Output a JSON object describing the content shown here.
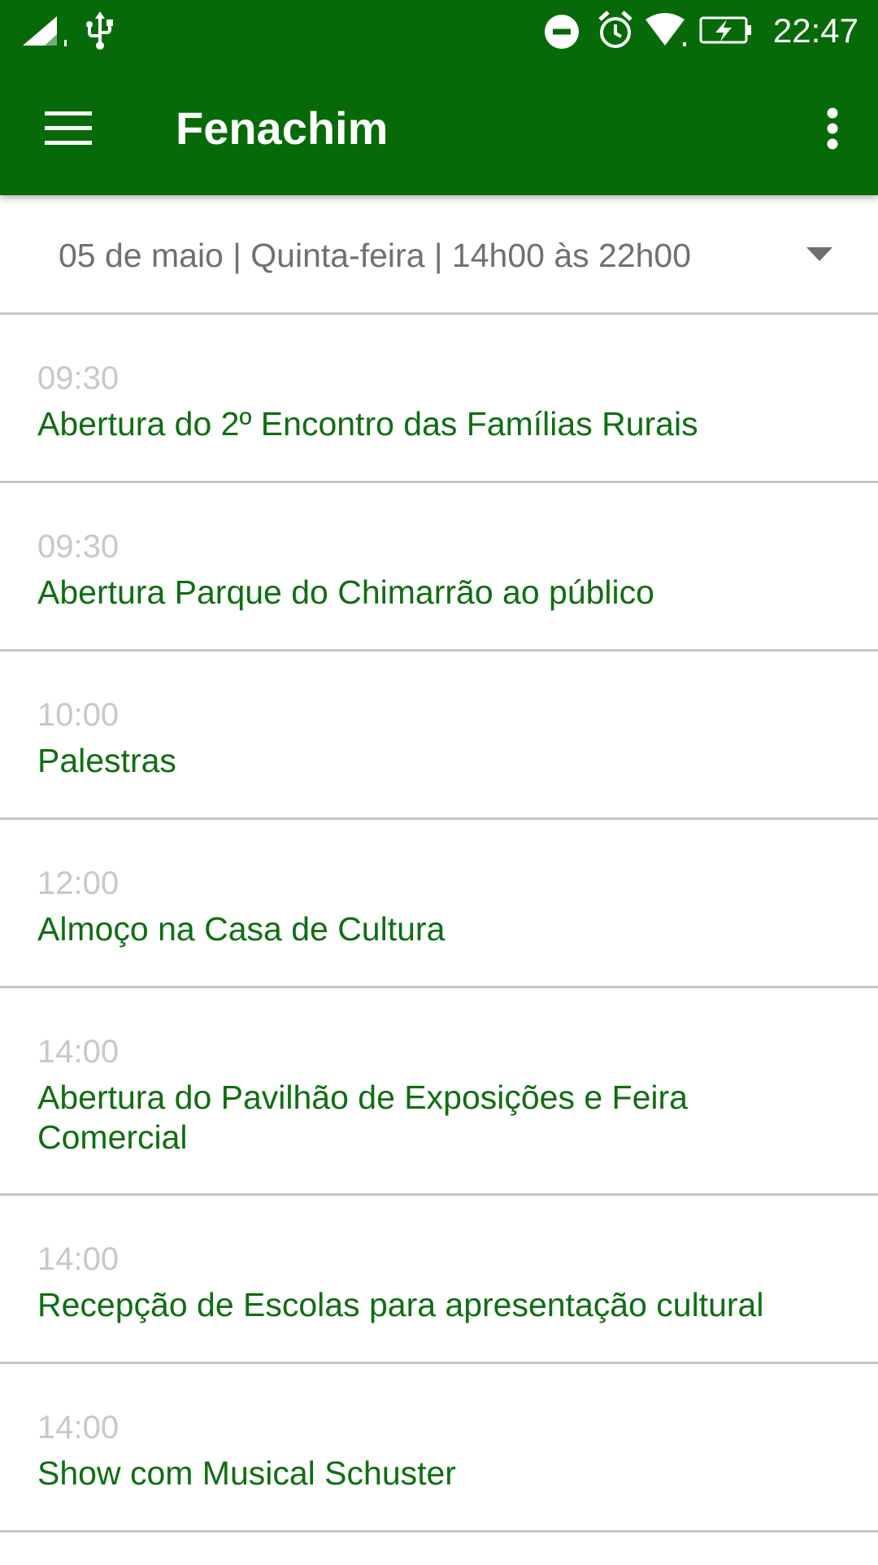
{
  "status_bar": {
    "time": "22:47",
    "icons": [
      "signal-icon",
      "usb-icon",
      "do-not-disturb-icon",
      "alarm-icon",
      "wifi-icon",
      "battery-charging-icon"
    ],
    "color": "#076a09"
  },
  "app_bar": {
    "title": "Fenachim",
    "menu_icon": "hamburger-menu-icon",
    "overflow_icon": "more-vert-icon",
    "color": "#076a09"
  },
  "date_selector": {
    "selected": "05 de maio | Quinta-feira | 14h00 às 22h00",
    "icon": "arrow-drop-down-icon"
  },
  "events": [
    {
      "time": "09:30",
      "title": "Abertura do 2º Encontro das Famílias Rurais"
    },
    {
      "time": "09:30",
      "title": "Abertura Parque do Chimarrão ao público"
    },
    {
      "time": "10:00",
      "title": "Palestras"
    },
    {
      "time": "12:00",
      "title": "Almoço na Casa de Cultura"
    },
    {
      "time": "14:00",
      "title": "Abertura do Pavilhão de Exposições e Feira Comercial"
    },
    {
      "time": "14:00",
      "title": "Recepção de Escolas para apresentação cultural"
    },
    {
      "time": "14:00",
      "title": "Show com Musical Schuster"
    }
  ],
  "colors": {
    "event_title": "#0f6e12",
    "event_time": "#c8c8c8",
    "date_text": "#707070"
  }
}
